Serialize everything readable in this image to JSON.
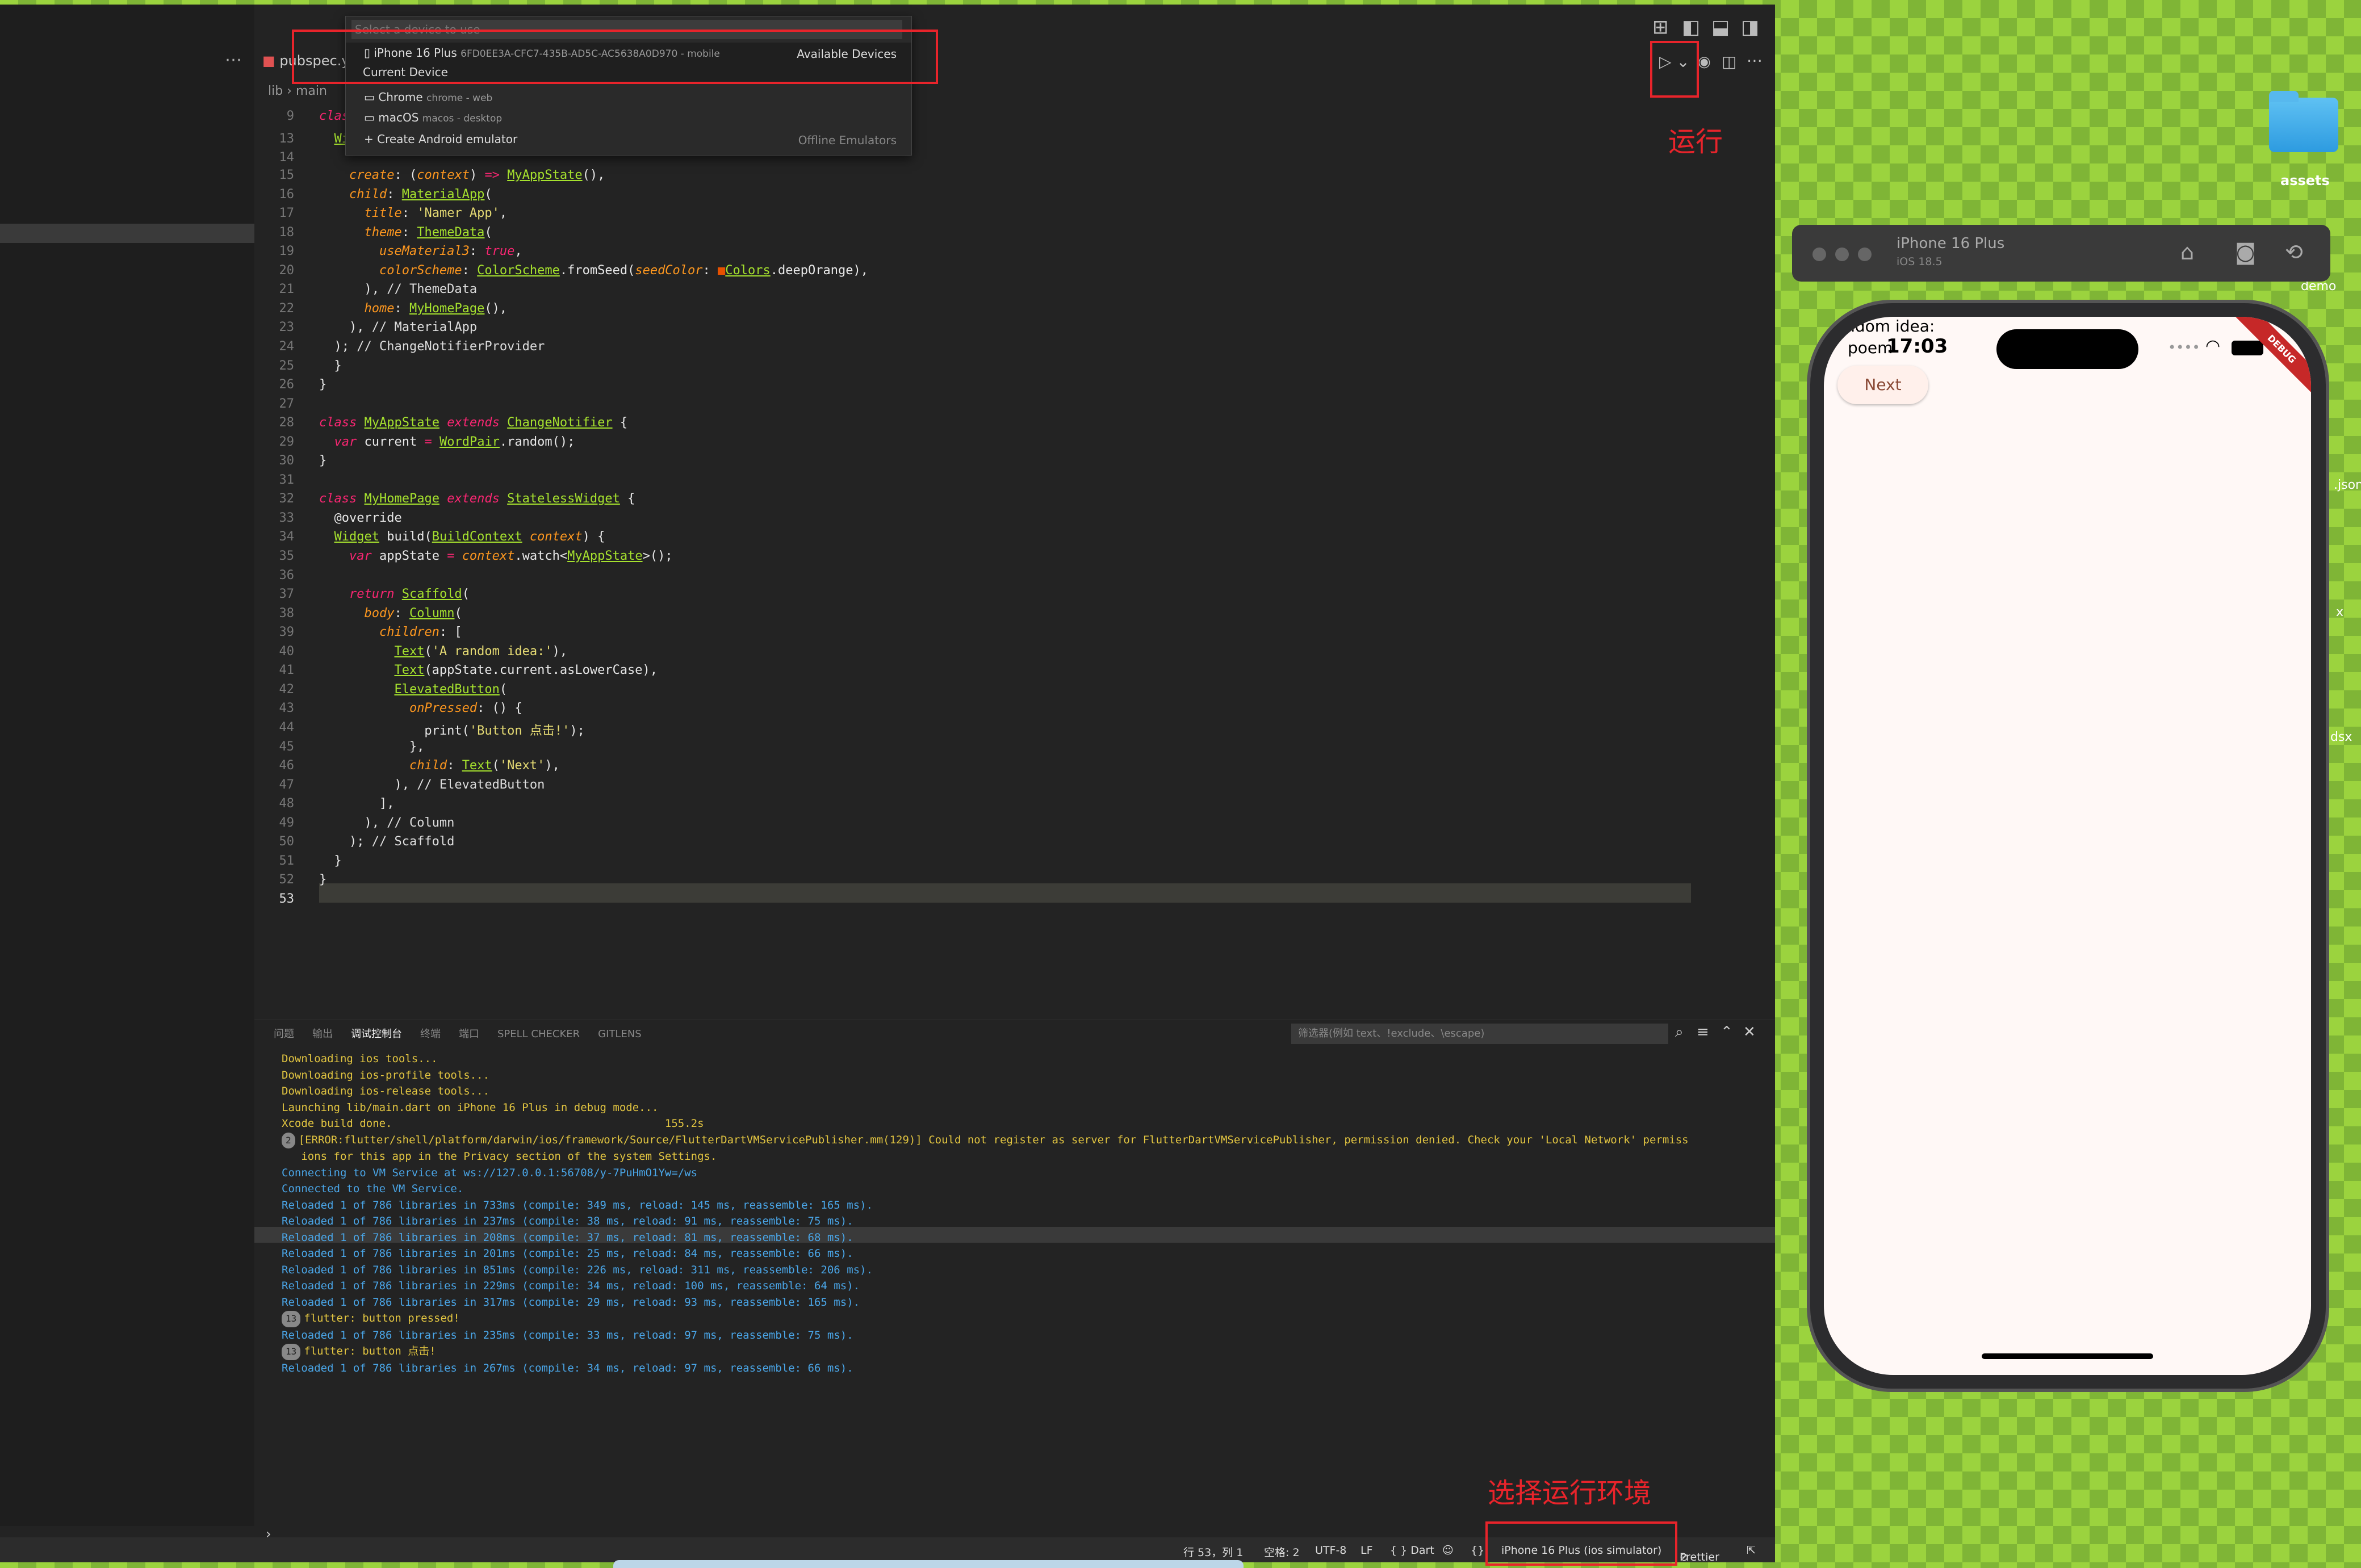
{
  "editor": {
    "tab": "pubspec.ya",
    "breadcrumb": "lib › main",
    "current_line": 53,
    "lines": [
      {
        "n": 9,
        "html": "<span class='kw'>class</span>"
      },
      {
        "n": 13,
        "html": "  <span class='cl'>Wi</span>"
      },
      {
        "n": 14,
        "html": ""
      },
      {
        "n": 15,
        "html": "    <span class='pm'>create</span>: (<span class='pm'>context</span>) <span class='kw'>=&gt;</span> <span class='cl'>MyAppState</span>(),"
      },
      {
        "n": 16,
        "html": "    <span class='pm'>child</span>: <span class='cl'>MaterialApp</span>("
      },
      {
        "n": 17,
        "html": "      <span class='pm'>title</span>: <span class='st'>'Namer App'</span>,"
      },
      {
        "n": 18,
        "html": "      <span class='pm'>theme</span>: <span class='cl'>ThemeData</span>("
      },
      {
        "n": 19,
        "html": "        <span class='pm'>useMaterial3</span>: <span class='kw'>true</span>,"
      },
      {
        "n": 20,
        "html": "        <span class='pm'>colorScheme</span>: <span class='cl'>ColorScheme</span>.fromSeed(<span class='pm'>seedColor</span>: <span style='color:#e65100'>■</span><span class='cl'>Colors</span>.deepOrange),"
      },
      {
        "n": 21,
        "html": "      ), <span class='cm'>// ThemeData</span>"
      },
      {
        "n": 22,
        "html": "      <span class='pm'>home</span>: <span class='cl'>MyHomePage</span>(),"
      },
      {
        "n": 23,
        "html": "    ), <span class='cm'>// MaterialApp</span>"
      },
      {
        "n": 24,
        "html": "  ); <span class='cm'>// ChangeNotifierProvider</span>"
      },
      {
        "n": 25,
        "html": "  }"
      },
      {
        "n": 26,
        "html": "}"
      },
      {
        "n": 27,
        "html": ""
      },
      {
        "n": 28,
        "html": "<span class='kw'>class</span> <span class='cl'>MyAppState</span> <span class='kw'>extends</span> <span class='cl'>ChangeNotifier</span> {"
      },
      {
        "n": 29,
        "html": "  <span class='kw'>var</span> current <span class='kw'>=</span> <span class='cl'>WordPair</span>.random();"
      },
      {
        "n": 30,
        "html": "}"
      },
      {
        "n": 31,
        "html": ""
      },
      {
        "n": 32,
        "html": "<span class='kw'>class</span> <span class='cl'>MyHomePage</span> <span class='kw'>extends</span> <span class='cl'>StatelessWidget</span> {"
      },
      {
        "n": 33,
        "html": "  @override"
      },
      {
        "n": 34,
        "html": "  <span class='cl'>Widget</span> build(<span class='cl'>BuildContext</span> <span class='pm'>context</span>) {"
      },
      {
        "n": 35,
        "html": "    <span class='kw'>var</span> appState <span class='kw'>=</span> <span class='pm'>context</span>.watch&lt;<span class='cl'>MyAppState</span>&gt;();"
      },
      {
        "n": 36,
        "html": ""
      },
      {
        "n": 37,
        "html": "    <span class='kw'>return</span> <span class='cl'>Scaffold</span>("
      },
      {
        "n": 38,
        "html": "      <span class='pm'>body</span>: <span class='cl'>Column</span>("
      },
      {
        "n": 39,
        "html": "        <span class='pm'>children</span>: ["
      },
      {
        "n": 40,
        "html": "          <span class='cl'>Text</span>(<span class='st'>'A random idea:'</span>),"
      },
      {
        "n": 41,
        "html": "          <span class='cl'>Text</span>(appState.current.asLowerCase),"
      },
      {
        "n": 42,
        "html": "          <span class='cl'>ElevatedButton</span>("
      },
      {
        "n": 43,
        "html": "            <span class='pm'>onPressed</span>: () {"
      },
      {
        "n": 44,
        "html": "              print(<span class='st'>'Button 点击!'</span>);"
      },
      {
        "n": 45,
        "html": "            },"
      },
      {
        "n": 46,
        "html": "            <span class='pm'>child</span>: <span class='cl'>Text</span>(<span class='st'>'Next'</span>),"
      },
      {
        "n": 47,
        "html": "          ), <span class='cm'>// ElevatedButton</span>"
      },
      {
        "n": 48,
        "html": "        ],"
      },
      {
        "n": 49,
        "html": "      ), <span class='cm'>// Column</span>"
      },
      {
        "n": 50,
        "html": "    ); <span class='cm'>// Scaffold</span>"
      },
      {
        "n": 51,
        "html": "  }"
      },
      {
        "n": 52,
        "html": "}"
      },
      {
        "n": 53,
        "html": ""
      }
    ]
  },
  "device_picker": {
    "placeholder": "Select a device to use",
    "selected_name": "iPhone 16 Plus",
    "selected_meta": "6FD0EE3A-CFC7-435B-AD5C-AC5638A0D970 - mobile",
    "selected_group": "Available Devices",
    "current_label": "Current Device",
    "chrome_name": "Chrome",
    "chrome_meta": "chrome - web",
    "macos_name": "macOS",
    "macos_meta": "macos - desktop",
    "android_label": "Create Android emulator",
    "android_group": "Offline Emulators"
  },
  "panel": {
    "tabs": [
      "问题",
      "输出",
      "调试控制台",
      "终端",
      "端口",
      "SPELL CHECKER",
      "GITLENS"
    ],
    "filter_placeholder": "筛选器(例如 text、!exclude、\\escape)",
    "log": [
      {
        "c": "y",
        "t": "Downloading ios tools..."
      },
      {
        "c": "y",
        "t": "Downloading ios-profile tools..."
      },
      {
        "c": "y",
        "t": "Downloading ios-release tools..."
      },
      {
        "c": "y",
        "t": "Launching lib/main.dart on iPhone 16 Plus in debug mode..."
      },
      {
        "c": "y",
        "t": "Xcode build done.                                          155.2s"
      },
      {
        "c": "y",
        "badge": "2",
        "t": "[ERROR:flutter/shell/platform/darwin/ios/framework/Source/FlutterDartVMServicePublisher.mm(129)] Could not register as server for FlutterDartVMServicePublisher, permission denied. Check your 'Local Network' permiss"
      },
      {
        "c": "y",
        "t": "   ions for this app in the Privacy section of the system Settings."
      },
      {
        "c": "b",
        "t": "Connecting to VM Service at ws://127.0.0.1:56708/y-7PuHmO1Yw=/ws"
      },
      {
        "c": "b",
        "t": "Connected to the VM Service."
      },
      {
        "c": "b",
        "t": "Reloaded 1 of 786 libraries in 733ms (compile: 349 ms, reload: 145 ms, reassemble: 165 ms)."
      },
      {
        "c": "b",
        "t": "Reloaded 1 of 786 libraries in 237ms (compile: 38 ms, reload: 91 ms, reassemble: 75 ms)."
      },
      {
        "c": "b",
        "t": "Reloaded 1 of 786 libraries in 208ms (compile: 37 ms, reload: 81 ms, reassemble: 68 ms)."
      },
      {
        "c": "b",
        "t": "Reloaded 1 of 786 libraries in 201ms (compile: 25 ms, reload: 84 ms, reassemble: 66 ms)."
      },
      {
        "c": "b",
        "t": "Reloaded 1 of 786 libraries in 851ms (compile: 226 ms, reload: 311 ms, reassemble: 206 ms)."
      },
      {
        "c": "b",
        "t": "Reloaded 1 of 786 libraries in 229ms (compile: 34 ms, reload: 100 ms, reassemble: 64 ms)."
      },
      {
        "c": "b",
        "t": "Reloaded 1 of 786 libraries in 317ms (compile: 29 ms, reload: 93 ms, reassemble: 165 ms)."
      },
      {
        "c": "y",
        "badge": "13",
        "t": "flutter: button pressed!"
      },
      {
        "c": "b",
        "t": "Reloaded 1 of 786 libraries in 235ms (compile: 33 ms, reload: 97 ms, reassemble: 75 ms)."
      },
      {
        "c": "y",
        "badge": "13",
        "t": "flutter: button 点击!"
      },
      {
        "c": "b",
        "t": "Reloaded 1 of 786 libraries in 267ms (compile: 34 ms, reload: 97 ms, reassemble: 66 ms)."
      }
    ]
  },
  "statusbar": {
    "position": "行 53，列 1",
    "spaces": "空格: 2",
    "encoding": "UTF-8",
    "eol": "LF",
    "language": "{ } Dart",
    "device": "iPhone 16 Plus (ios simulator)",
    "prettier": "Prettier"
  },
  "annotations": {
    "run": "运行",
    "choose_env": "选择运行环境",
    "color": "#e8242b"
  },
  "desktop": {
    "folder_label": "assets",
    "simulator_title": "iPhone 16 Plus",
    "simulator_os": "iOS 18.5",
    "side_labels": [
      "demo",
      ".json",
      "x",
      "dsx"
    ]
  },
  "phone_app": {
    "time": "17:03",
    "idea_label": "andom idea:",
    "word": "poem",
    "button": "Next",
    "banner": "DEBUG"
  }
}
